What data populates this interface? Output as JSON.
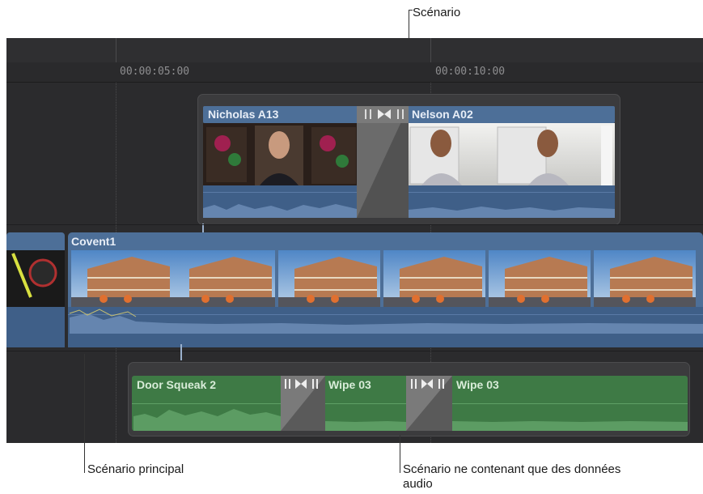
{
  "callouts": {
    "storyline": "Scénario",
    "primary_storyline": "Scénario principal",
    "audio_storyline_line1": "Scénario ne contenant que des données",
    "audio_storyline_line2": "audio"
  },
  "ruler": {
    "timecode_1": "00:00:05:00",
    "timecode_2": "00:00:10:00"
  },
  "storyline_clips": {
    "clip_1": "Nicholas A13",
    "clip_2": "Nelson A02"
  },
  "primary_clips": {
    "clip_1": "Covent1"
  },
  "audio_storyline_clips": {
    "clip_1": "Door Squeak 2",
    "clip_2": "Wipe 03",
    "clip_3": "Wipe 03"
  },
  "icons": {
    "transition": "transition-icon"
  },
  "colors": {
    "timeline_bg": "#2b2b2d",
    "video_clip_blue": "#4d6f98",
    "audio_clip_green": "#3e7a45",
    "transition_gray": "#6a6a6a"
  }
}
